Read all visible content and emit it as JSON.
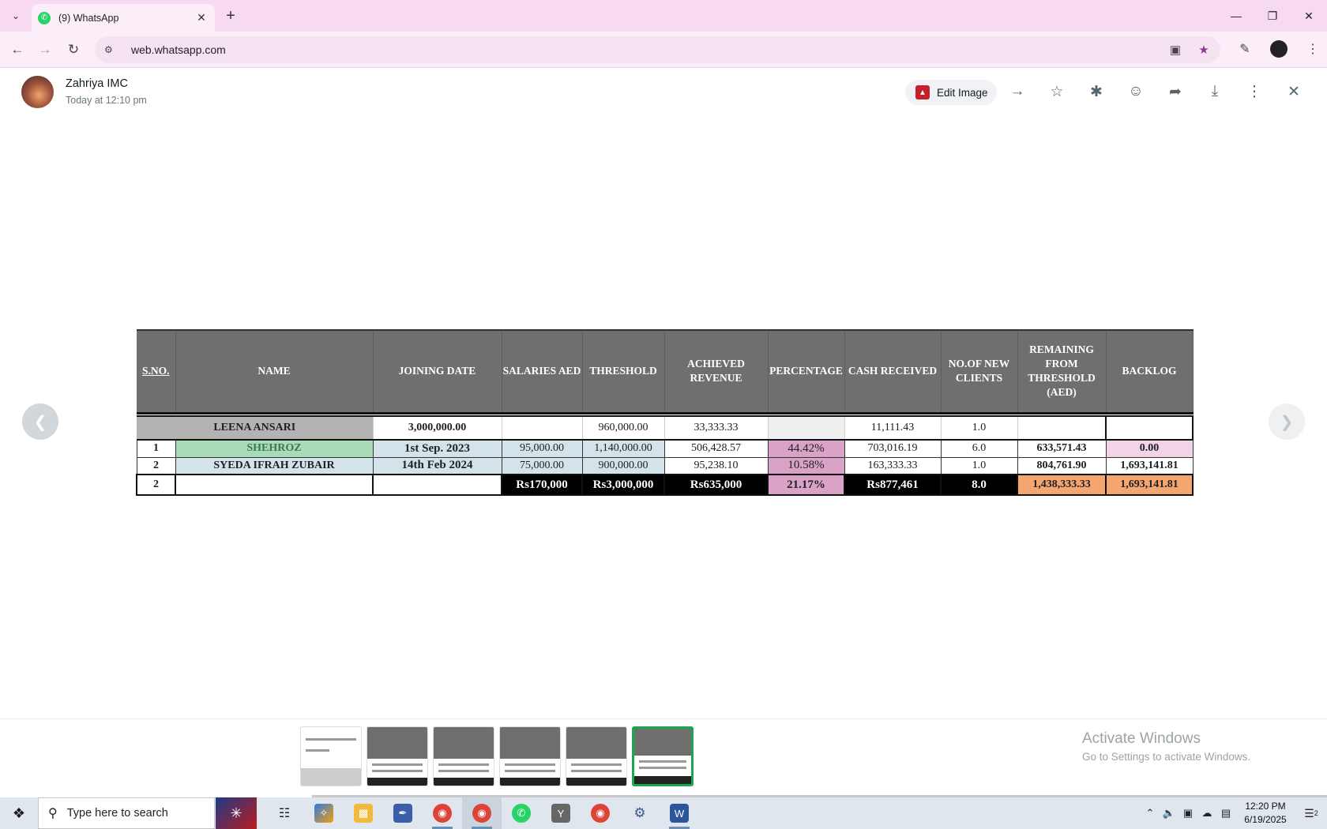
{
  "browser": {
    "tab_title": "(9) WhatsApp",
    "url": "web.whatsapp.com"
  },
  "viewer": {
    "sender_name": "Zahriya IMC",
    "sent_time": "Today at 12:10 pm",
    "edit_image_label": "Edit Image"
  },
  "sheet": {
    "headers": {
      "sno": "S.NO.",
      "name": "NAME",
      "joining_date": "JOINING DATE",
      "salaries": "SALARIES AED",
      "threshold": "THRESHOLD",
      "achieved": "ACHIEVED REVENUE",
      "percentage": "PERCENTAGE",
      "cash": "CASH RECEIVED",
      "clients": "NO.OF NEW CLIENTS",
      "remaining": "REMAINING FROM THRESHOLD (AED)",
      "backlog": "BACKLOG"
    },
    "leena": {
      "name": "LEENA ANSARI",
      "joining": "3,000,000.00",
      "threshold": "960,000.00",
      "achieved": "33,333.33",
      "cash": "11,111.43",
      "clients": "1.0"
    },
    "rows": [
      {
        "sno": "1",
        "name": "SHEHROZ",
        "joining": "1st Sep. 2023",
        "salary": "95,000.00",
        "threshold": "1,140,000.00",
        "achieved": "506,428.57",
        "percentage": "44.42%",
        "cash": "703,016.19",
        "clients": "6.0",
        "remaining": "633,571.43",
        "backlog": "0.00"
      },
      {
        "sno": "2",
        "name": "SYEDA IFRAH ZUBAIR",
        "joining": "14th Feb 2024",
        "salary": "75,000.00",
        "threshold": "900,000.00",
        "achieved": "95,238.10",
        "percentage": "10.58%",
        "cash": "163,333.33",
        "clients": "1.0",
        "remaining": "804,761.90",
        "backlog": "1,693,141.81"
      }
    ],
    "total": {
      "sno": "2",
      "salary": "Rs170,000",
      "threshold": "Rs3,000,000",
      "achieved": "Rs635,000",
      "percentage": "21.17%",
      "cash": "Rs877,461",
      "clients": "8.0",
      "remaining": "1,438,333.33",
      "backlog": "1,693,141.81"
    }
  },
  "watermark": {
    "title": "Activate Windows",
    "subtitle": "Go to Settings to activate Windows."
  },
  "taskbar": {
    "search_placeholder": "Type here to search",
    "time": "12:20 PM",
    "date": "6/19/2025",
    "notification_count": "2"
  },
  "colors": {
    "tabbar": "#f7d9f1",
    "header_gray": "#6f6f6f",
    "percentage_pink": "#d9a2c6",
    "remaining_orange": "#f4a671",
    "name_green": "#a9dbb9",
    "name_blue": "#d4e3ea",
    "active_thumb": "#1aa653"
  }
}
